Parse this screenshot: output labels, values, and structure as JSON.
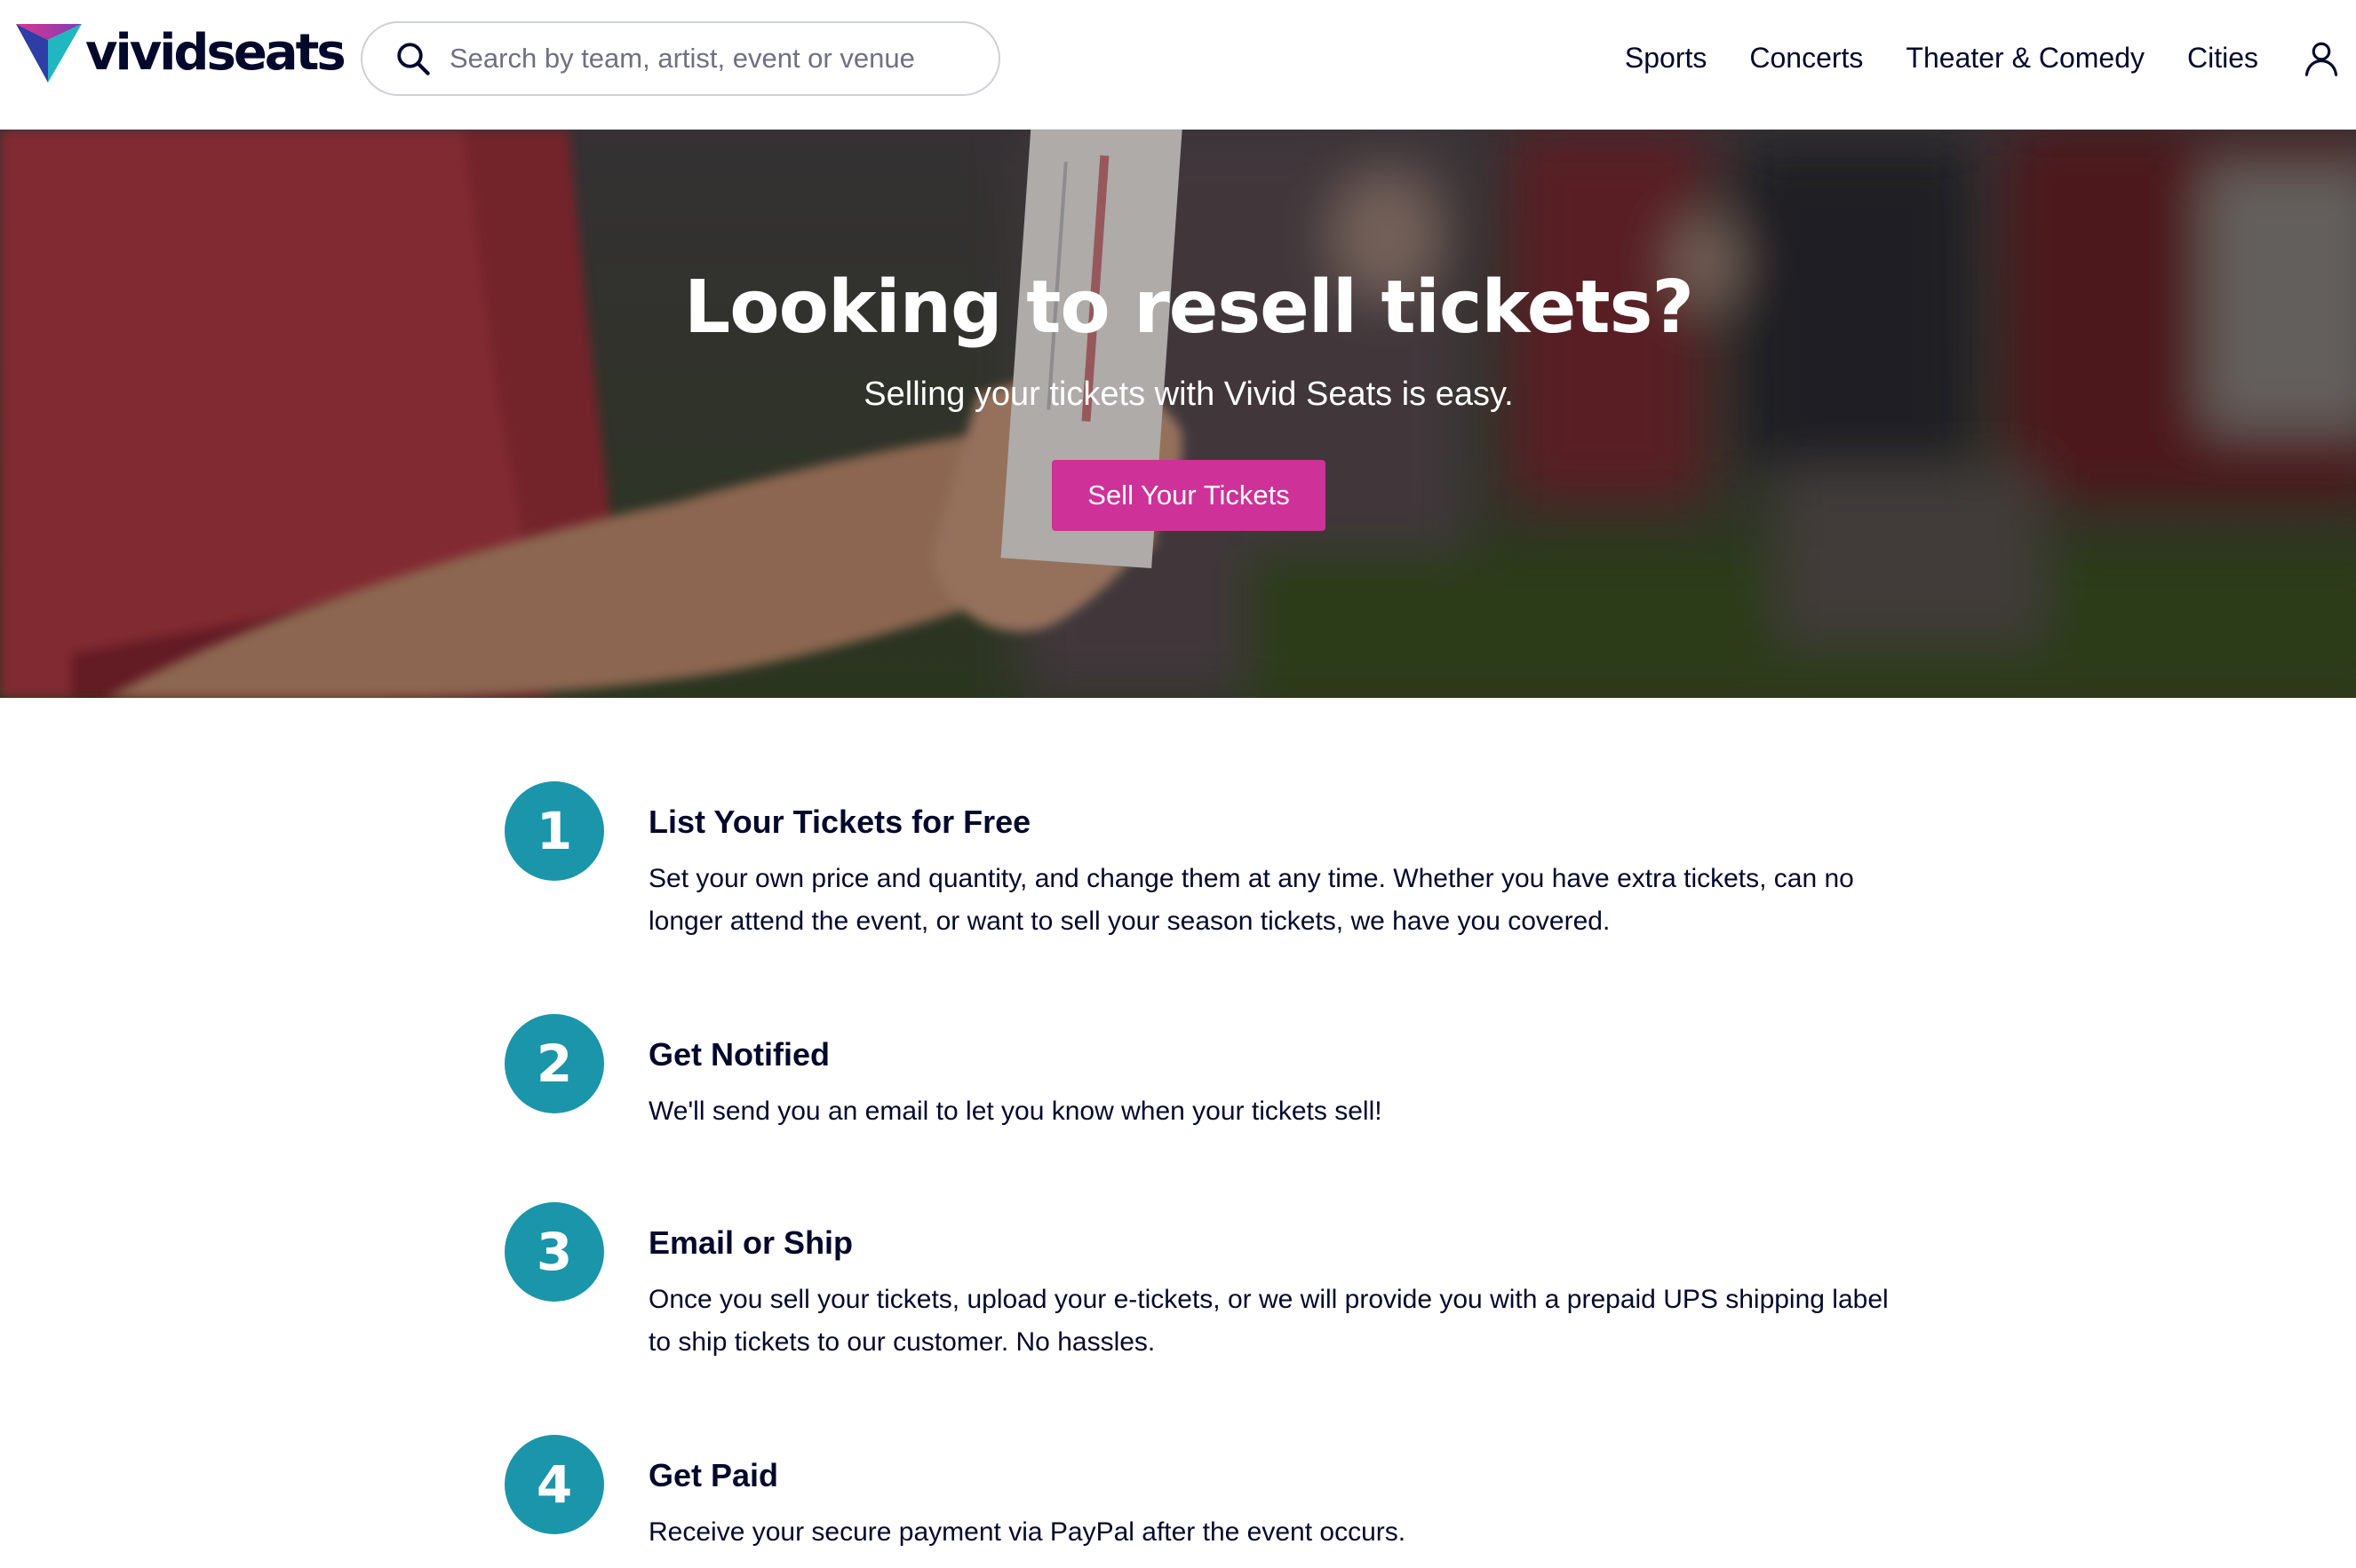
{
  "header": {
    "logo_text": "vividseats",
    "search_placeholder": "Search by team, artist, event or venue",
    "nav": [
      "Sports",
      "Concerts",
      "Theater & Comedy",
      "Cities"
    ]
  },
  "hero": {
    "title": "Looking to resell tickets?",
    "subtitle": "Selling your tickets with Vivid Seats is easy.",
    "button_label": "Sell Your Tickets",
    "button_color": "#ce3197"
  },
  "steps": [
    {
      "number": "1",
      "title": "List Your Tickets for Free",
      "text": "Set your own price and quantity, and change them at any time. Whether you have extra tickets, can no longer attend the event, or want to sell your season tickets, we have you covered."
    },
    {
      "number": "2",
      "title": "Get Notified",
      "text": "We'll send you an email to let you know when your tickets sell!"
    },
    {
      "number": "3",
      "title": "Email or Ship",
      "text": "Once you sell your tickets, upload your e-tickets, or we will provide you with a prepaid UPS shipping label to ship tickets to our customer. No hassles."
    },
    {
      "number": "4",
      "title": "Get Paid",
      "text": "Receive your secure payment via PayPal after the event occurs."
    }
  ],
  "colors": {
    "step_circle": "#1b95a9",
    "text_dark": "#04092c",
    "accent_pink": "#ce3197"
  },
  "icons": {
    "logo": "vividseats-triangle-logo-icon",
    "search": "search-icon",
    "user": "user-account-icon"
  }
}
